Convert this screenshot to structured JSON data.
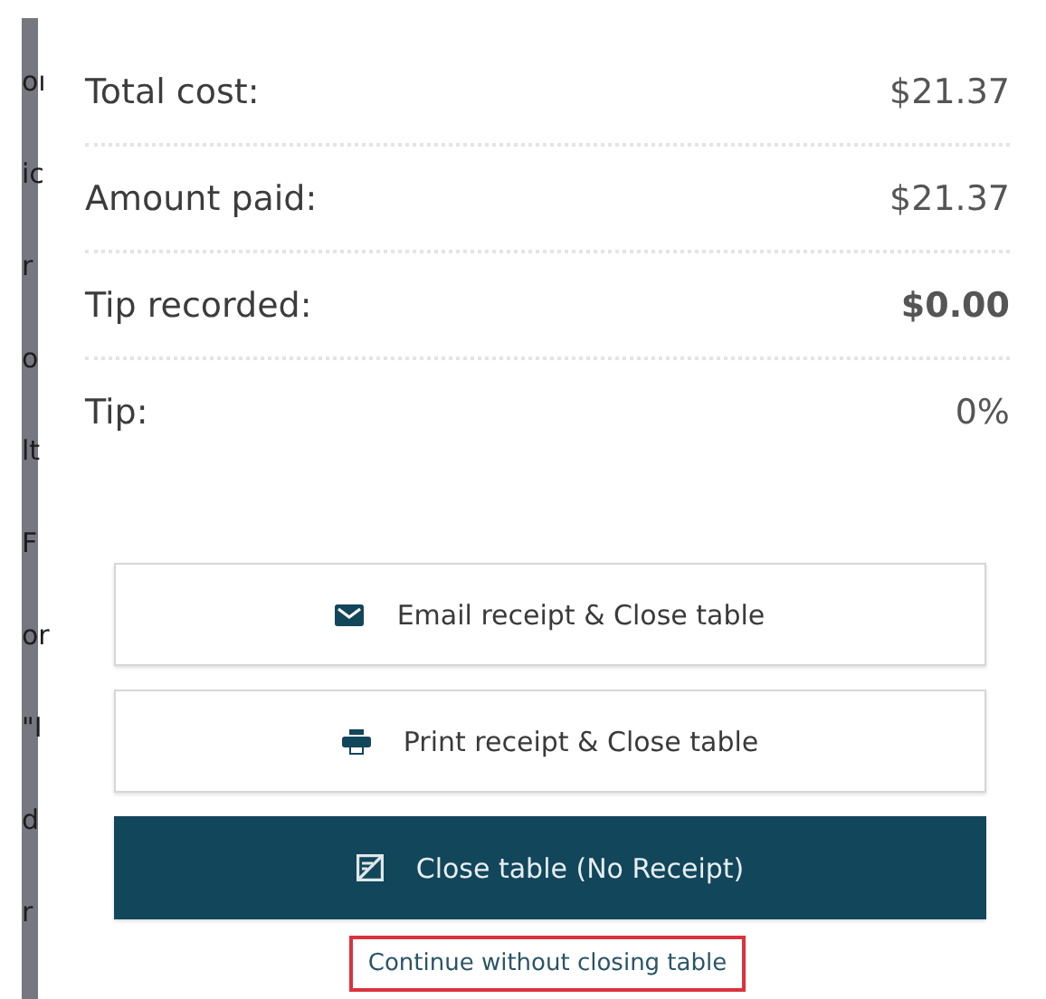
{
  "background_fragments": [
    {
      "text": "oı"
    },
    {
      "text": "ic"
    },
    {
      "text": "r"
    },
    {
      "text": "o"
    },
    {
      "text": "lt"
    },
    {
      "text": "F"
    },
    {
      "text": "or"
    },
    {
      "text": "\"I"
    },
    {
      "text": "d"
    },
    {
      "text": "r"
    }
  ],
  "summary": [
    {
      "label": "Total cost:",
      "value": "$21.37",
      "bold": false
    },
    {
      "label": "Amount paid:",
      "value": "$21.37",
      "bold": false
    },
    {
      "label": "Tip recorded:",
      "value": "$0.00",
      "bold": true
    },
    {
      "label": "Tip:",
      "value": "0%",
      "bold": false
    }
  ],
  "actions": [
    {
      "kind": "email",
      "label": "Email receipt & Close table",
      "primary": false
    },
    {
      "kind": "print",
      "label": "Print receipt & Close table",
      "primary": false
    },
    {
      "kind": "no-receipt",
      "label": "Close table (No Receipt)",
      "primary": true
    }
  ],
  "link": {
    "label": "Continue without closing table",
    "highlighted": true
  }
}
